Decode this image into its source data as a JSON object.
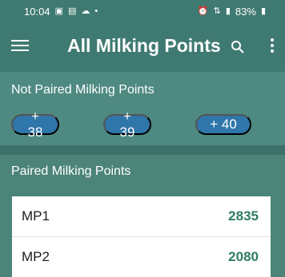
{
  "status_bar": {
    "time": "10:04",
    "battery": "83%",
    "left_icons": [
      "image-icon",
      "calendar-icon",
      "cloud-icon",
      "dot-icon"
    ],
    "right_icons": [
      "alarm-icon",
      "volte-icon",
      "signal-icon",
      "battery-icon"
    ]
  },
  "app_bar": {
    "title": "All Milking Points",
    "menu_icon": "hamburger-menu-icon",
    "search_icon": "search-icon",
    "more_icon": "more-vert-icon"
  },
  "not_paired": {
    "title": "Not Paired Milking Points",
    "chips": [
      "+ 38",
      "+ 39",
      "+ 40"
    ]
  },
  "paired": {
    "title": "Paired Milking Points",
    "rows": [
      {
        "name": "MP1",
        "value": "2835"
      },
      {
        "name": "MP2",
        "value": "2080"
      }
    ]
  },
  "colors": {
    "app_bar": "#3f7a72",
    "not_paired_bg": "#4e8a81",
    "paired_bg": "#4c8479",
    "chip": "#2f76aa",
    "value_text": "#2e7d5f"
  }
}
